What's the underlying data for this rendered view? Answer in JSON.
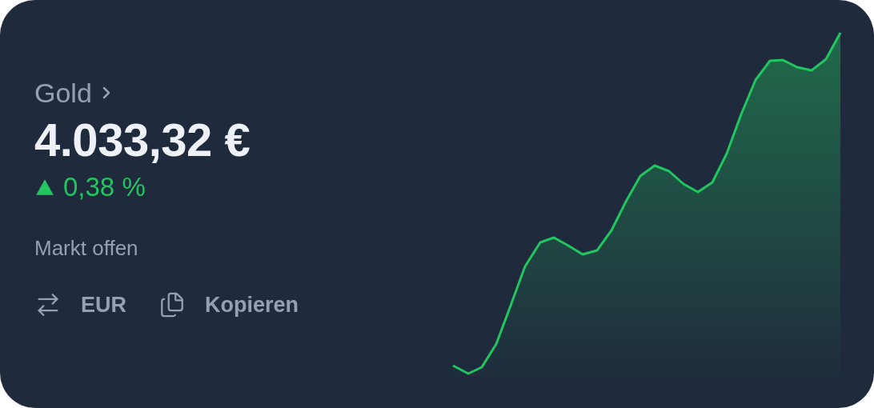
{
  "asset": {
    "name": "Gold"
  },
  "price": "4.033,32 €",
  "change": {
    "rising": true,
    "value": "0,38 %"
  },
  "market_status": "Markt offen",
  "actions": [
    {
      "kind": "currency",
      "label": "EUR"
    },
    {
      "kind": "copy",
      "label": "Kopieren"
    }
  ]
}
